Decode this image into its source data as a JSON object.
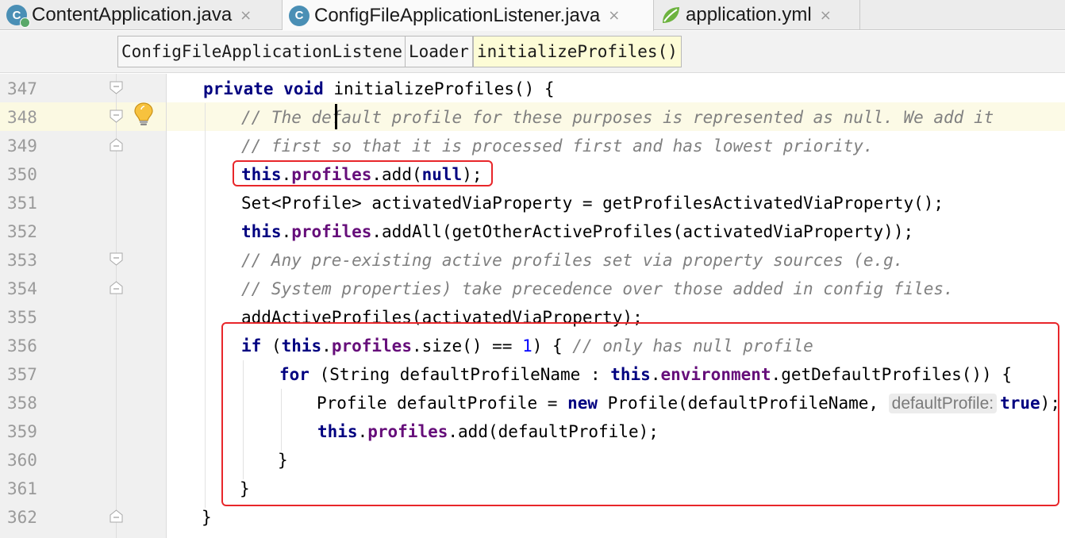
{
  "tabs": [
    {
      "label": "ContentApplication.java",
      "icon": "spring-boot-class-icon"
    },
    {
      "label": "ConfigFileApplicationListener.java",
      "icon": "java-class-icon"
    },
    {
      "label": "application.yml",
      "icon": "spring-leaf-icon"
    }
  ],
  "tab_close_glyph": "×",
  "breadcrumbs": [
    "ConfigFileApplicationListener",
    "Loader",
    "initializeProfiles()"
  ],
  "line_numbers": [
    "347",
    "348",
    "349",
    "350",
    "351",
    "352",
    "353",
    "354",
    "355",
    "356",
    "357",
    "358",
    "359",
    "360",
    "361",
    "362"
  ],
  "code": {
    "l347": {
      "kw1": "private",
      "kw2": "void",
      "rest": "initializeProfiles() {"
    },
    "l348": {
      "comment": "// The default profile for these purposes is represented as null. We add it"
    },
    "l349": {
      "comment": "// first so that it is processed first and has lowest priority."
    },
    "l350": {
      "this": "this",
      "dot1": ".",
      "field": "profiles",
      "mid": ".add(",
      "null": "null",
      "end": ");"
    },
    "l351": {
      "text": "Set<Profile> activatedViaProperty = getProfilesActivatedViaProperty();"
    },
    "l352": {
      "this": "this",
      "dot1": ".",
      "field": "profiles",
      "rest": ".addAll(getOtherActiveProfiles(activatedViaProperty));"
    },
    "l353": {
      "comment": "// Any pre-existing active profiles set via property sources (e.g."
    },
    "l354": {
      "comment": "// System properties) take precedence over those added in config files."
    },
    "l355": {
      "text": "addActiveProfiles(activatedViaProperty);"
    },
    "l356": {
      "if": "if",
      "open": " (",
      "this": "this",
      "dot": ".",
      "field": "profiles",
      "mid": ".size() == ",
      "num": "1",
      "close": ") { ",
      "comment": "// only has null profile"
    },
    "l357": {
      "for": "for",
      "mid": " (String defaultProfileName : ",
      "this": "this",
      "dot": ".",
      "field": "environment",
      "rest": ".getDefaultProfiles()) {"
    },
    "l358": {
      "pre": "Profile defaultProfile = ",
      "new": "new",
      "mid": " Profile(defaultProfileName, ",
      "hint": "defaultProfile:",
      "true": "true",
      "end": ");"
    },
    "l359": {
      "this": "this",
      "dot": ".",
      "field": "profiles",
      "rest": ".add(defaultProfile);"
    },
    "l360": {
      "text": "}"
    },
    "l361": {
      "text": "}"
    },
    "l362": {
      "text": "}"
    }
  },
  "colors": {
    "keyword": "#000080",
    "field": "#660e7a",
    "comment": "#808080",
    "number": "#0000ff",
    "annotation_box": "#e8262a",
    "caret_line": "#fcfae6"
  },
  "icons": [
    "intention-bulb-icon",
    "fold-marker-icon"
  ]
}
